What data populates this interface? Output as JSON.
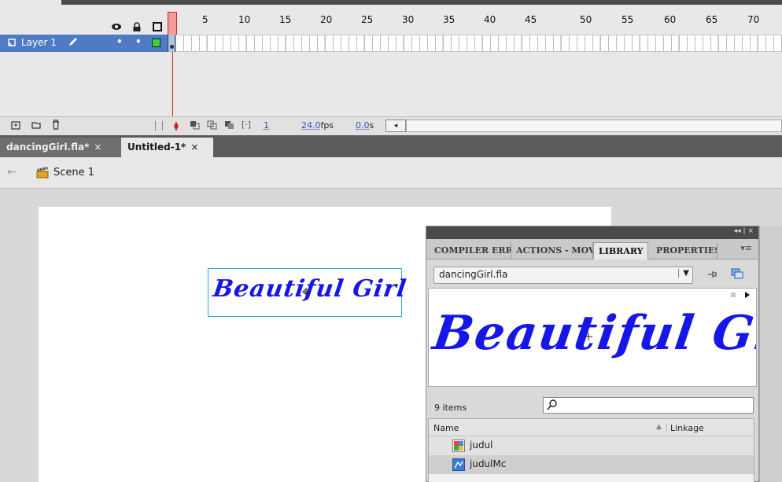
{
  "timeline": {
    "header_icons": [
      "eye-icon",
      "lock-icon",
      "outline-icon"
    ],
    "current_frame": "1",
    "frame_numbers": [
      "5",
      "10",
      "15",
      "20",
      "25",
      "30",
      "35",
      "40",
      "45",
      "50",
      "55",
      "60",
      "65",
      "70"
    ],
    "layer": {
      "name": "Layer 1",
      "dot1": "•",
      "dot2": "•"
    },
    "footer": {
      "frame": "1",
      "fps": "24.0",
      "fps_unit": "fps",
      "time": "0.0",
      "time_unit": "s"
    }
  },
  "doc_tabs": [
    {
      "label": "dancingGirl.fla*",
      "close": "×"
    },
    {
      "label": "Untitled-1*",
      "close": "×"
    }
  ],
  "edit_bar": {
    "scene": "Scene 1"
  },
  "stage": {
    "title_text": "Beautiful Girl"
  },
  "library_panel": {
    "collapse": "◂◂ | ×",
    "tabs": [
      "COMPILER ERRORS",
      "ACTIONS - MOVIE CLIP",
      "LIBRARY",
      "PROPERTIES"
    ],
    "menu": "▾≡",
    "doc_select": "dancingGirl.fla",
    "preview_text": "Beautiful Girl",
    "item_count": "9 items",
    "search_value": "",
    "columns": {
      "name": "Name",
      "linkage": "Linkage"
    },
    "items": [
      {
        "name": "judul",
        "icon": "bitmap-icon"
      },
      {
        "name": "judulMc",
        "icon": "movieclip-icon"
      }
    ]
  },
  "colors": {
    "selection_blue": "#4f7bc4",
    "text_blue": "#1616e8",
    "playhead_red": "#d41f1f"
  }
}
